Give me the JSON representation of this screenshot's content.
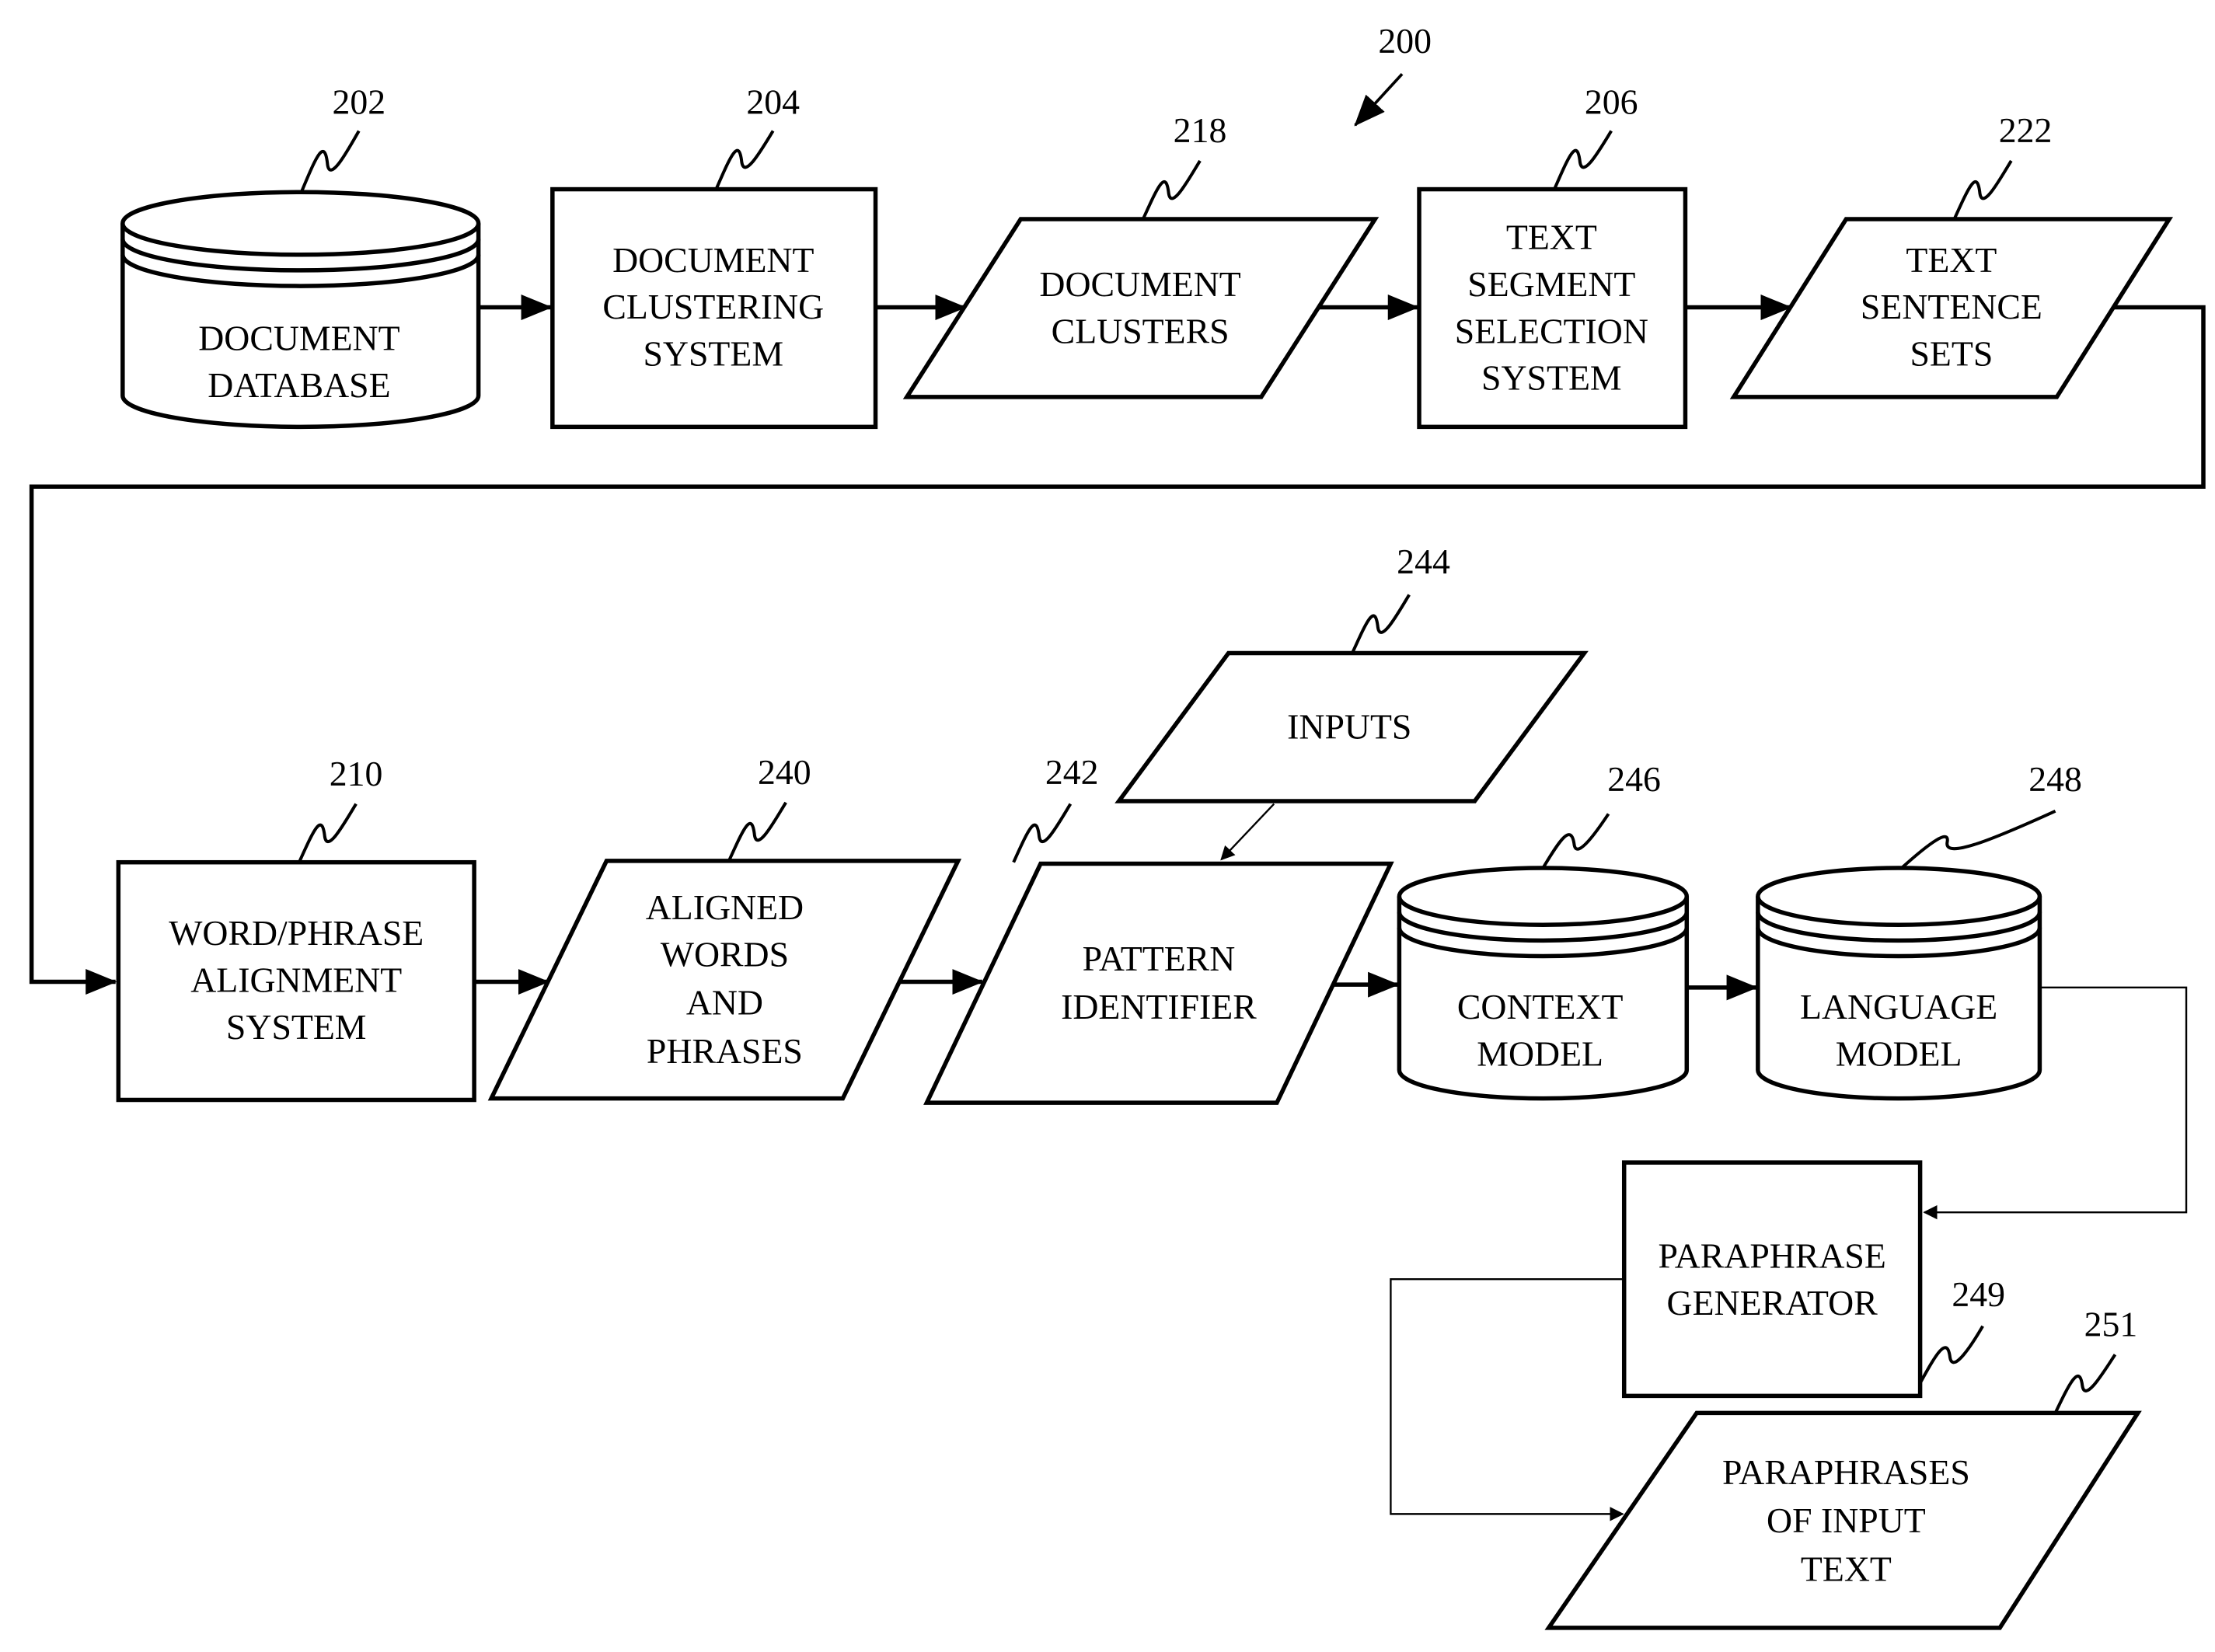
{
  "figure_ref": "200",
  "nodes": {
    "document_database": {
      "ref": "202",
      "lines": [
        "DOCUMENT",
        "DATABASE"
      ],
      "shape": "cylinder"
    },
    "document_clustering_system": {
      "ref": "204",
      "lines": [
        "DOCUMENT",
        "CLUSTERING",
        "SYSTEM"
      ],
      "shape": "rectangle"
    },
    "document_clusters": {
      "ref": "218",
      "lines": [
        "DOCUMENT",
        "CLUSTERS"
      ],
      "shape": "parallelogram"
    },
    "text_segment_selection_system": {
      "ref": "206",
      "lines": [
        "TEXT",
        "SEGMENT",
        "SELECTION",
        "SYSTEM"
      ],
      "shape": "rectangle"
    },
    "text_sentence_sets": {
      "ref": "222",
      "lines": [
        "TEXT",
        "SENTENCE",
        "SETS"
      ],
      "shape": "parallelogram"
    },
    "word_phrase_alignment_system": {
      "ref": "210",
      "lines": [
        "WORD/PHRASE",
        "ALIGNMENT",
        "SYSTEM"
      ],
      "shape": "rectangle"
    },
    "aligned_words_and_phrases": {
      "ref": "240",
      "lines": [
        "ALIGNED",
        "WORDS",
        "AND",
        "PHRASES"
      ],
      "shape": "parallelogram"
    },
    "pattern_identifier": {
      "ref": "242",
      "lines": [
        "PATTERN",
        "IDENTIFIER"
      ],
      "shape": "parallelogram"
    },
    "inputs": {
      "ref": "244",
      "lines": [
        "INPUTS"
      ],
      "shape": "parallelogram"
    },
    "context_model": {
      "ref": "246",
      "lines": [
        "CONTEXT",
        "MODEL"
      ],
      "shape": "cylinder"
    },
    "language_model": {
      "ref": "248",
      "lines": [
        "LANGUAGE",
        "MODEL"
      ],
      "shape": "cylinder"
    },
    "paraphrase_generator": {
      "ref": "249",
      "lines": [
        "PARAPHRASE",
        "GENERATOR"
      ],
      "shape": "rectangle"
    },
    "paraphrases_of_input_text": {
      "ref": "251",
      "lines": [
        "PARAPHRASES",
        "OF INPUT",
        "TEXT"
      ],
      "shape": "parallelogram"
    }
  },
  "edges": [
    [
      "document_database",
      "document_clustering_system"
    ],
    [
      "document_clustering_system",
      "document_clusters"
    ],
    [
      "document_clusters",
      "text_segment_selection_system"
    ],
    [
      "text_segment_selection_system",
      "text_sentence_sets"
    ],
    [
      "text_sentence_sets",
      "word_phrase_alignment_system"
    ],
    [
      "word_phrase_alignment_system",
      "aligned_words_and_phrases"
    ],
    [
      "aligned_words_and_phrases",
      "pattern_identifier"
    ],
    [
      "inputs",
      "pattern_identifier"
    ],
    [
      "pattern_identifier",
      "context_model"
    ],
    [
      "context_model",
      "language_model"
    ],
    [
      "language_model",
      "paraphrase_generator"
    ],
    [
      "paraphrase_generator",
      "paraphrases_of_input_text"
    ]
  ]
}
